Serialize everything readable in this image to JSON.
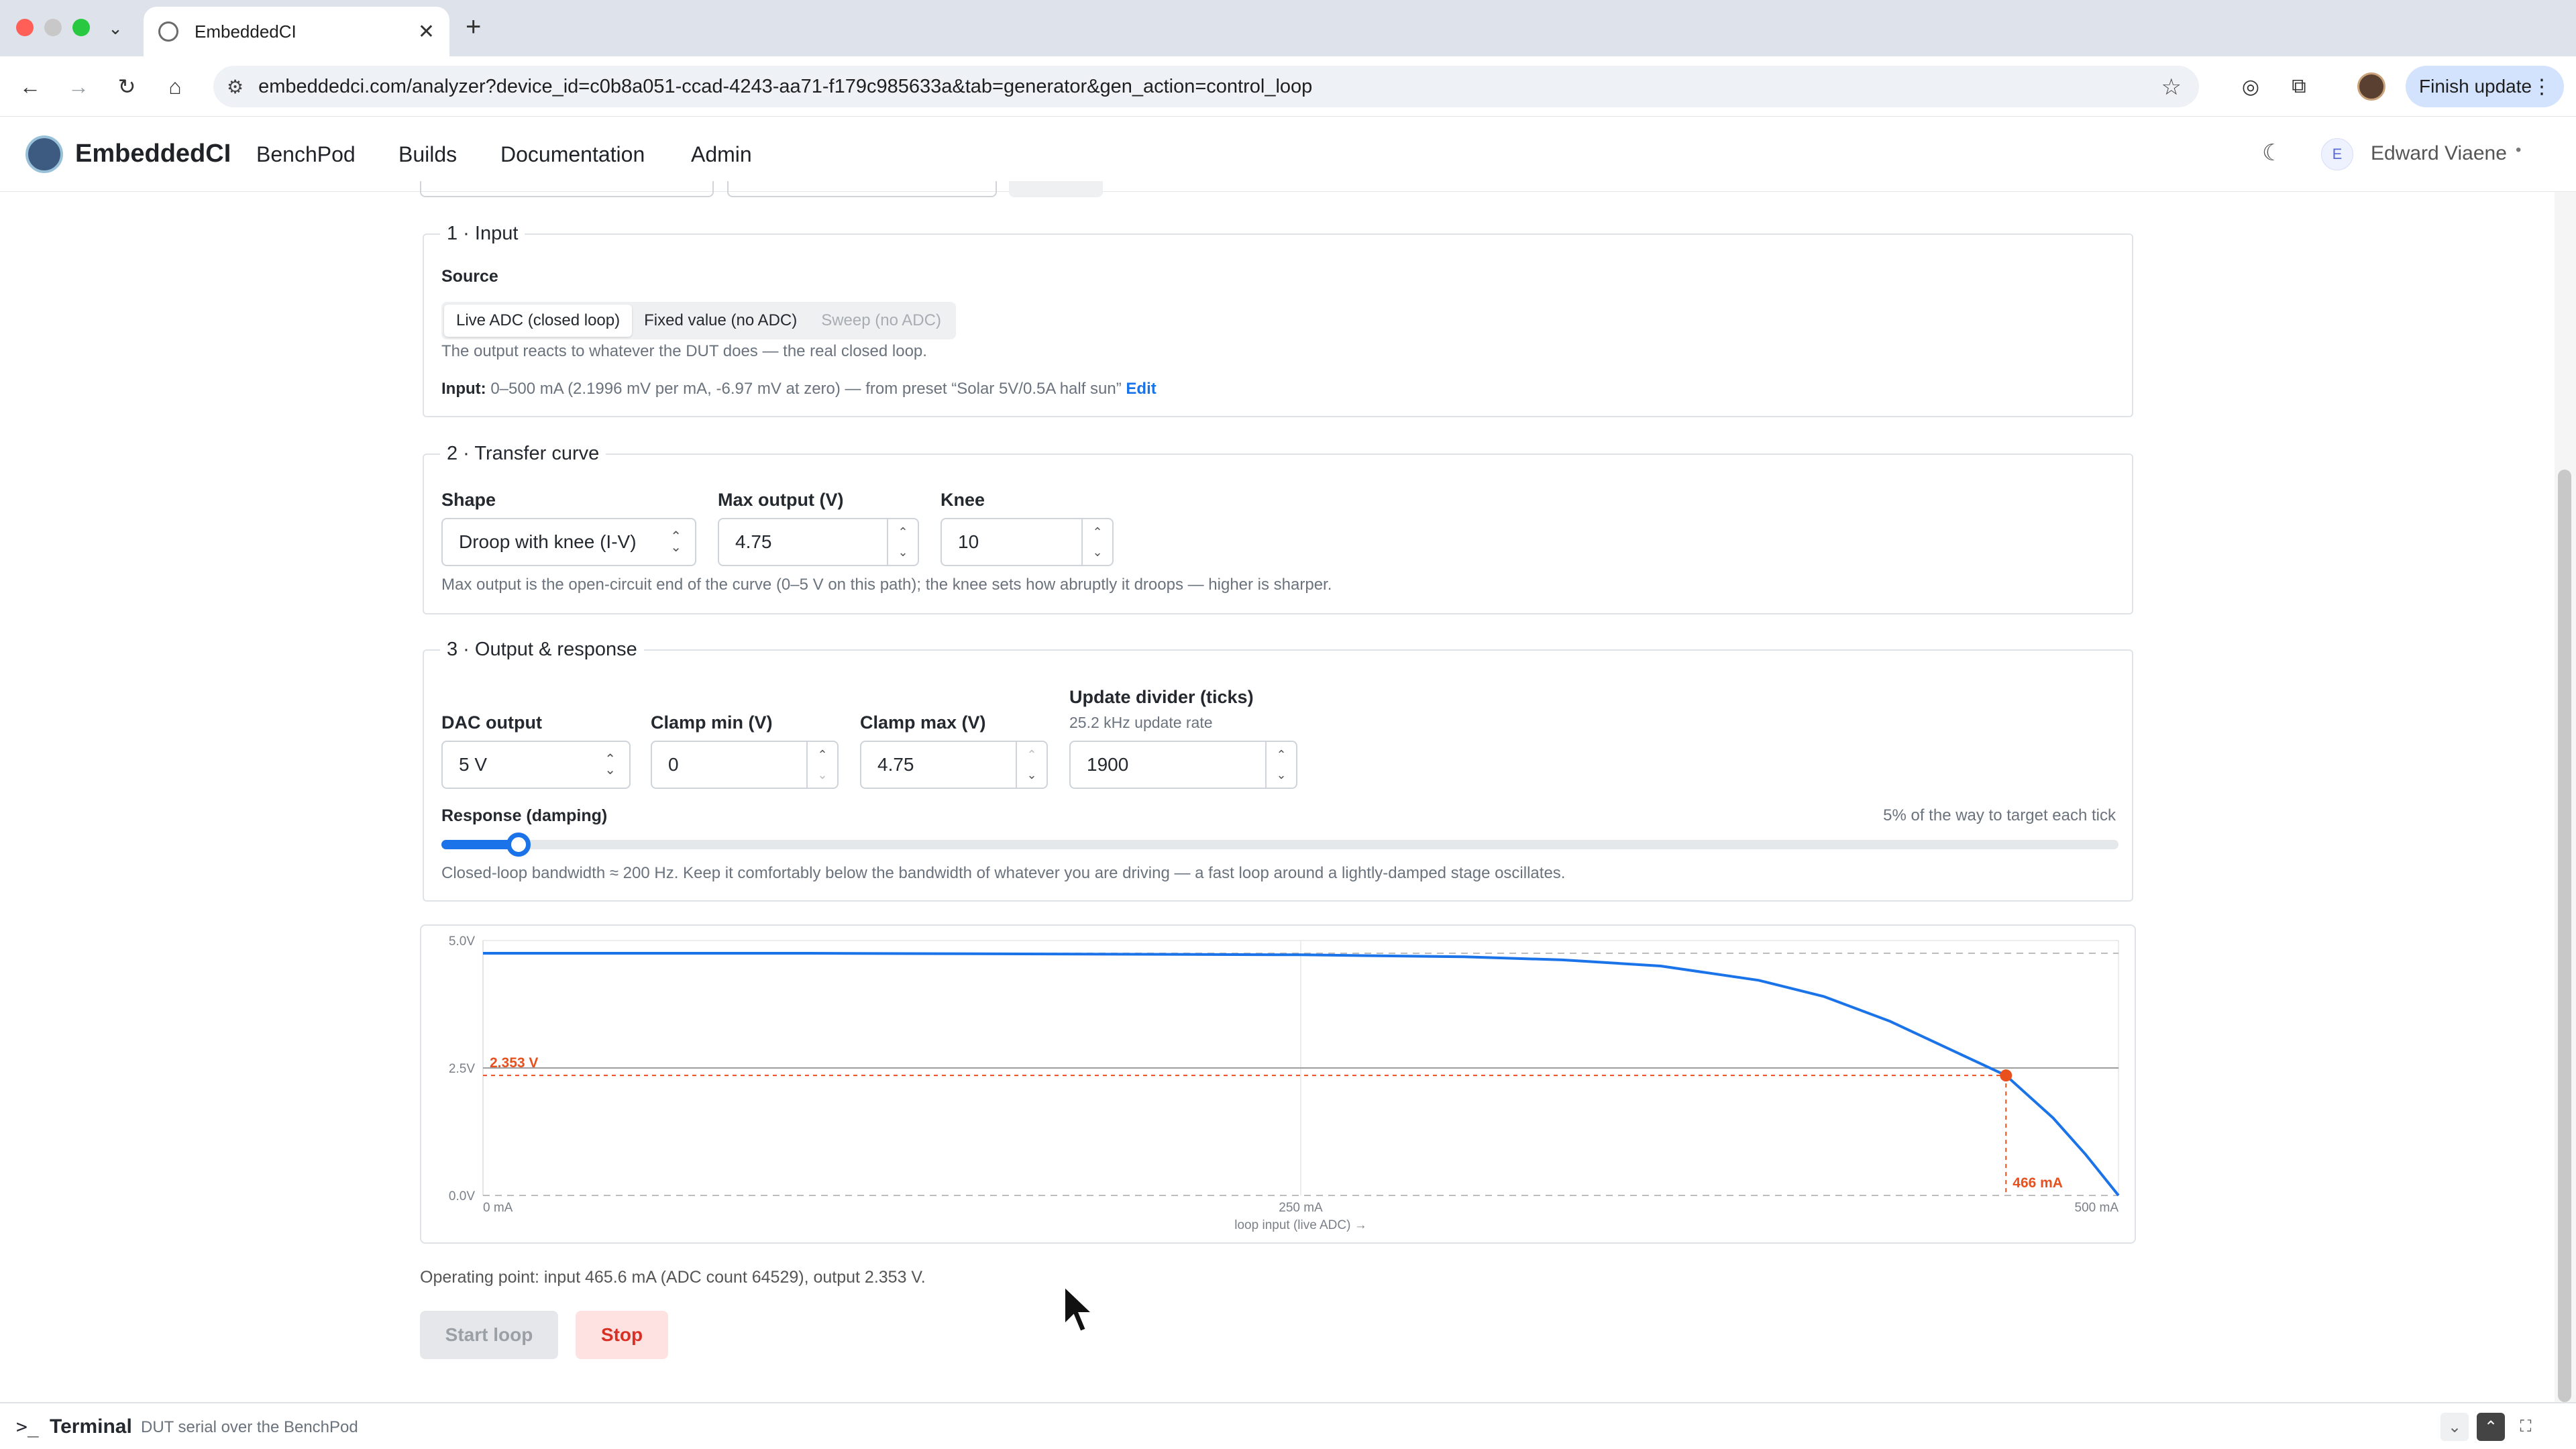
{
  "browser": {
    "tab_title": "EmbeddedCI",
    "url": "embeddedci.com/analyzer?device_id=c0b8a051-ccad-4243-aa71-f179c985633a&tab=generator&gen_action=control_loop",
    "finish_update_label": "Finish update"
  },
  "app": {
    "brand": "EmbeddedCI",
    "nav": [
      "BenchPod",
      "Builds",
      "Documentation",
      "Admin"
    ],
    "user_initial": "E",
    "user_name": "Edward Viaene"
  },
  "input_section": {
    "legend": "1 · Input",
    "source_label": "Source",
    "source_options": [
      "Live ADC (closed loop)",
      "Fixed value (no ADC)",
      "Sweep (no ADC)"
    ],
    "source_selected": "Live ADC (closed loop)",
    "source_hint": "The output reacts to whatever the DUT does — the real closed loop.",
    "input_label": "Input:",
    "input_desc": "0–500 mA (2.1996 mV per mA, -6.97 mV at zero) — from preset “Solar 5V/0.5A half sun”",
    "edit_link": "Edit"
  },
  "transfer_section": {
    "legend": "2 · Transfer curve",
    "shape_label": "Shape",
    "shape_value": "Droop with knee (I-V)",
    "max_output_label": "Max output (V)",
    "max_output_value": "4.75",
    "knee_label": "Knee",
    "knee_value": "10",
    "hint": "Max output is the open-circuit end of the curve (0–5 V on this path); the knee sets how abruptly it droops — higher is sharper."
  },
  "output_section": {
    "legend": "3 · Output & response",
    "dac_label": "DAC output",
    "dac_value": "5 V",
    "clamp_min_label": "Clamp min (V)",
    "clamp_min_value": "0",
    "clamp_max_label": "Clamp max (V)",
    "clamp_max_value": "4.75",
    "divider_label": "Update divider (ticks)",
    "divider_sub": "25.2 kHz update rate",
    "divider_value": "1900",
    "response_label": "Response (damping)",
    "response_right": "5% of the way to target each tick",
    "response_fraction": 0.046,
    "bandwidth_hint": "Closed-loop bandwidth ≈ 200 Hz. Keep it comfortably below the bandwidth of whatever you are driving — a fast loop around a lightly-damped stage oscillates."
  },
  "chart_data": {
    "type": "line",
    "x_range": [
      0,
      500
    ],
    "y_range": [
      0,
      5
    ],
    "x_ticks": [
      "0 mA",
      "250 mA",
      "500 mA"
    ],
    "x_tick_values": [
      0,
      250,
      500
    ],
    "y_ticks": [
      "0.0V",
      "2.5V",
      "5.0V"
    ],
    "y_tick_values": [
      0,
      2.5,
      5
    ],
    "xlabel": "loop input (live ADC) →",
    "reference_lines": {
      "clamp_max_v": 4.75,
      "clamp_min_v": 0,
      "midline_v": 2.5
    },
    "series": [
      {
        "x": [
          0,
          50,
          100,
          150,
          200,
          250,
          300,
          330,
          360,
          390,
          410,
          430,
          450,
          465.6,
          480,
          490,
          500
        ],
        "y": [
          4.75,
          4.75,
          4.75,
          4.74,
          4.73,
          4.72,
          4.68,
          4.62,
          4.5,
          4.22,
          3.9,
          3.42,
          2.82,
          2.353,
          1.52,
          0.8,
          0.0
        ]
      }
    ],
    "operating_point": {
      "x": 465.6,
      "y": 2.353,
      "x_label": "466 mA",
      "y_label": "2.353 V"
    },
    "color": "#1a73e8",
    "marker_color": "#e8501e"
  },
  "operating_point_text": "Operating point: input 465.6 mA (ADC count 64529), output 2.353 V.",
  "actions": {
    "start": "Start loop",
    "stop": "Stop"
  },
  "terminal": {
    "title": "Terminal",
    "subtitle": "DUT serial over the BenchPod"
  }
}
